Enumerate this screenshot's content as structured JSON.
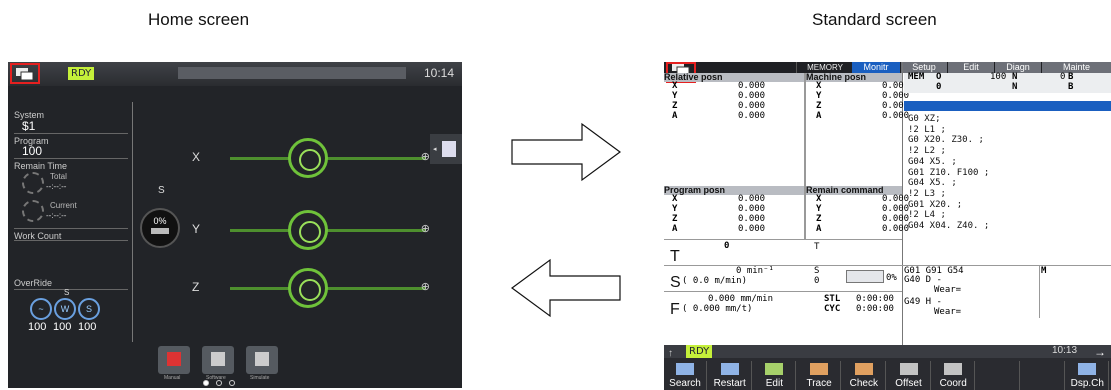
{
  "captions": {
    "home": "Home screen",
    "standard": "Standard screen"
  },
  "home": {
    "status": "RDY",
    "time": "10:14",
    "system_label": "System",
    "system_value": "$1",
    "program_label": "Program",
    "program_value": "100",
    "remain_time_label": "Remain Time",
    "total_label": "Total",
    "total_value": "--:--:--",
    "current_label": "Current",
    "current_value": "--:--:--",
    "work_count_label": "Work Count",
    "override_label": "OverRide",
    "override_values": [
      "100",
      "100",
      "100"
    ],
    "override_s_label": "S",
    "spindle_label": "S",
    "spindle_value": "0%",
    "axes": [
      "X",
      "Y",
      "Z"
    ],
    "tile_labels": [
      "Manual",
      "Software",
      "Simulate"
    ],
    "colors": {
      "accent": "#6fc23a",
      "status": "#c5f03a",
      "highlight": "#e52020"
    }
  },
  "standard": {
    "mode": "MEMORY",
    "tabs": [
      "Monitr",
      "Setup",
      "Edit",
      "Diagn",
      "Mainte"
    ],
    "rel_title": "Relative posn",
    "mach_title": "Machine posn",
    "prog_title": "Program posn",
    "remain_title": "Remain command",
    "axes": [
      "X",
      "Y",
      "Z",
      "A"
    ],
    "zero": "0.000",
    "mem_row": {
      "mem": "MEM",
      "o": "O",
      "o_val": "100",
      "n": "N",
      "n_val": "0",
      "b": "B"
    },
    "mem_row2": {
      "o_val2": "0",
      "n2": "N",
      "b2": "B"
    },
    "program_lines": [
      "G0 XZ;",
      "!2 L1 ;",
      "G0 X20. Z30. ;",
      "!2 L2 ;",
      "G04 X5. ;",
      "G01 Z10. F100 ;",
      "G04 X5. ;",
      "!2 L3 ;",
      "G01 X20. ;",
      "!2 L4 ;",
      "G04 X04. Z40. ;"
    ],
    "t_label": "T",
    "t_value": "0",
    "t_label2": "T",
    "s_label": "S",
    "s_value": "0 min⁻¹",
    "s_paren": "(    0.0    m/min)",
    "s_label2": "S",
    "s_zero": "0",
    "s_pct": "0%",
    "f_label": "F",
    "f_value": "0.000 mm/min",
    "f_paren": "( 0.000     mm/t)",
    "stl_label": "STL",
    "stl_value": "0:00:00",
    "cyc_label": "CYC",
    "cyc_value": "0:00:00",
    "gcodes_1": "G01    G91 G54",
    "gcodes_2": "G40    D     -",
    "gcodes_3": "Wear=",
    "gcodes_4": "G49    H     -",
    "gcodes_5": "Wear=",
    "m_label": "M",
    "status": "RDY",
    "time": "10:13",
    "softkeys": [
      "Search",
      "Restart",
      "Edit",
      "Trace",
      "Check",
      "Offset",
      "Coord",
      "",
      "",
      "Dsp.Ch"
    ],
    "colors": {
      "tab_active": "#1a5fc0",
      "highlight": "#e52020"
    }
  }
}
